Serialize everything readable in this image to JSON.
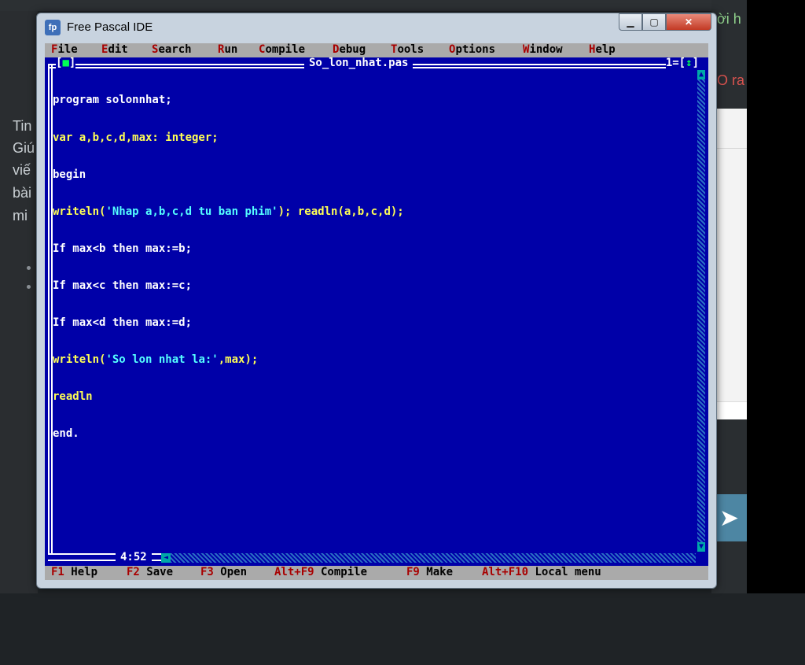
{
  "window": {
    "title": "Free Pascal IDE",
    "icon": "fpc-app-icon"
  },
  "background": {
    "right_text_1": "ời h",
    "right_text_2": "O ra",
    "left_texts": [
      "Tin",
      "Giú",
      "viế",
      "bài",
      "mi"
    ]
  },
  "menu": {
    "items": [
      {
        "hot": "F",
        "rest": "ile"
      },
      {
        "hot": "E",
        "rest": "dit"
      },
      {
        "hot": "S",
        "rest": "earch"
      },
      {
        "hot": "R",
        "rest": "un"
      },
      {
        "hot": "C",
        "rest": "ompile"
      },
      {
        "hot": "D",
        "rest": "ebug"
      },
      {
        "hot": "T",
        "rest": "ools"
      },
      {
        "hot": "O",
        "rest": "ptions"
      },
      {
        "hot": "W",
        "rest": "indow"
      },
      {
        "hot": "H",
        "rest": "elp"
      }
    ]
  },
  "editor": {
    "filename": "So_lon_nhat.pas",
    "close_marker_left": "[",
    "close_marker_mid": "■",
    "close_marker_right": "]",
    "window_number": "1=[",
    "zoom_marker": "↕",
    "zoom_close": "]",
    "cursor_position": "4:52",
    "code_lines": [
      "program solonnhat;",
      "var a,b,c,d,max: integer;",
      "begin",
      "writeln('Nhap a,b,c,d tu ban phim'); readln(a,b,c,d);",
      "If max<b then max:=b;",
      "If max<c then max:=c;",
      "If max<d then max:=d;",
      "writeln('So lon nhat la:',max);",
      "readln",
      "end."
    ]
  },
  "status": {
    "items": [
      {
        "key": "F1",
        "label": " Help"
      },
      {
        "key": "F2",
        "label": " Save"
      },
      {
        "key": "F3",
        "label": " Open"
      },
      {
        "key": "Alt+F9",
        "label": " Compile"
      },
      {
        "key": "F9",
        "label": " Make"
      },
      {
        "key": "Alt+F10",
        "label": " Local menu"
      }
    ]
  },
  "colors": {
    "console_bg": "#0000a8",
    "menu_bg": "#aaaaaa",
    "hotkey": "#a80000",
    "identifier": "#ffff55",
    "string": "#55ffff"
  }
}
